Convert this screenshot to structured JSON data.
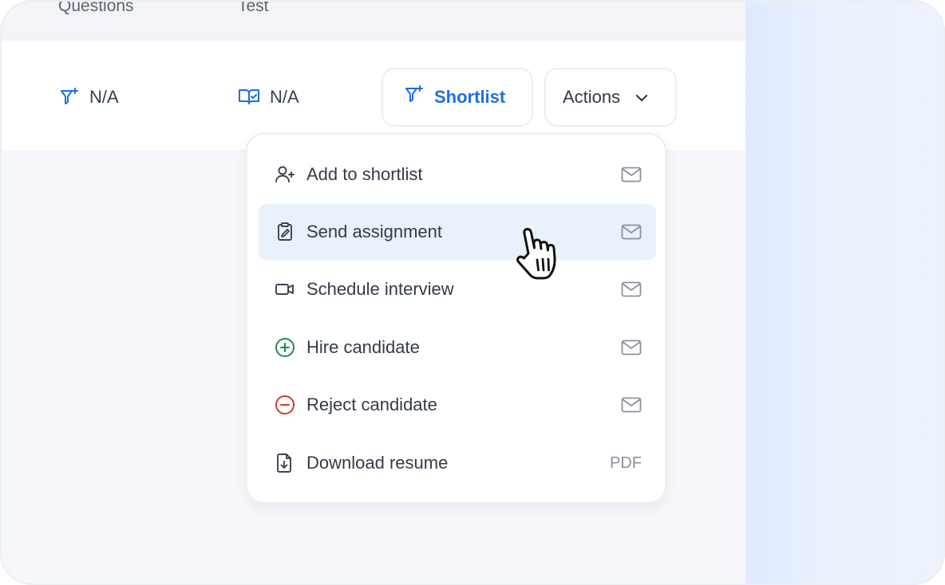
{
  "table": {
    "headers": {
      "questions": "Questions",
      "test": "Test"
    },
    "row": {
      "questions_value": "N/A",
      "test_value": "N/A"
    }
  },
  "toolbar": {
    "shortlist_label": "Shortlist",
    "actions_label": "Actions"
  },
  "actions_menu": {
    "items": [
      {
        "label": "Add to shortlist",
        "icon": "user-plus-icon",
        "trailing": "mail-icon"
      },
      {
        "label": "Send assignment",
        "icon": "clipboard-edit-icon",
        "trailing": "mail-icon",
        "highlighted": true
      },
      {
        "label": "Schedule interview",
        "icon": "video-icon",
        "trailing": "mail-icon"
      },
      {
        "label": "Hire candidate",
        "icon": "plus-circle-icon",
        "trailing": "mail-icon"
      },
      {
        "label": "Reject candidate",
        "icon": "minus-circle-icon",
        "trailing": "mail-icon"
      },
      {
        "label": "Download resume",
        "icon": "file-download-icon",
        "trailing_text": "PDF"
      }
    ]
  },
  "colors": {
    "accent": "#1d6fe6",
    "hire": "#1f8a5b",
    "reject": "#d8372f",
    "highlight": "#e9f1fd"
  }
}
